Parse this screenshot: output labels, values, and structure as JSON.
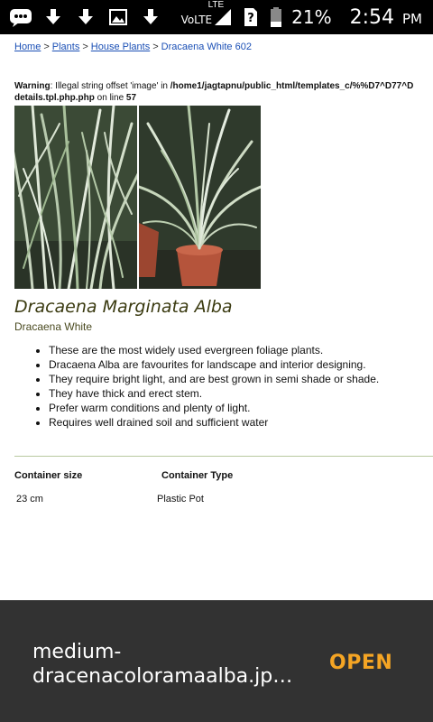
{
  "status_bar": {
    "network_label": "VoLTE",
    "lte_label": "LTE",
    "battery_percent": "21%",
    "time": "2:54",
    "ampm": "PM"
  },
  "breadcrumb": {
    "items": [
      "Home",
      "Plants",
      "House Plants"
    ],
    "separator": ">",
    "current": "Dracaena White 602"
  },
  "warning": {
    "label": "Warning",
    "message": ": Illegal string offset 'image' in ",
    "path": "/home1/jagtapnu/public_html/templates_c/%%D7^D77^D",
    "path_end": "details.tpl.php.php",
    "line_text": " on line ",
    "line_number": "57"
  },
  "product": {
    "title": "Dracaena Marginata Alba",
    "subtitle": "Dracaena White",
    "features": [
      "These are the most widely used evergreen foliage plants.",
      "Dracaena Alba are favourites for landscape and interior designing.",
      "They require bright light, and are best grown in semi shade or shade.",
      "They have thick and erect stem.",
      "Prefer warm conditions and plenty of light.",
      "Requires well drained soil and sufficient water"
    ]
  },
  "specs": {
    "container_size_label": "Container size",
    "container_type_label": "Container Type",
    "container_size_value": "23 cm",
    "container_type_value": "Plastic Pot"
  },
  "download": {
    "filename": "medium-dracenacoloramaalba.jp…",
    "filename_line1": "medium-",
    "filename_line2": "dracenacoloramaalba.jp…",
    "action_label": "OPEN",
    "action_color": "#f5a524"
  }
}
